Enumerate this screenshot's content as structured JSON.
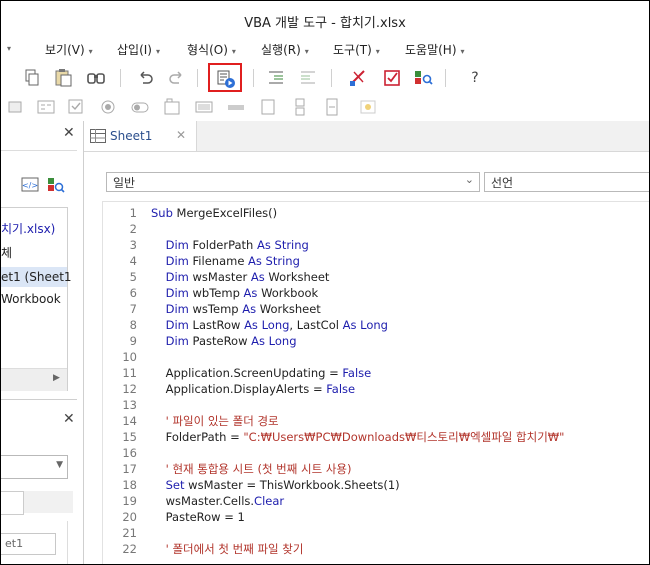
{
  "window": {
    "title": "VBA 개발 도구 - 합치기.xlsx"
  },
  "menu": [
    {
      "label": "보기(V)"
    },
    {
      "label": "삽입(I)"
    },
    {
      "label": "형식(O)"
    },
    {
      "label": "실행(R)"
    },
    {
      "label": "도구(T)"
    },
    {
      "label": "도움말(H)"
    }
  ],
  "toolbar": {
    "help_label": "?"
  },
  "project_panel": {
    "items": [
      "치기.xlsx)",
      "체",
      "et1 (Sheet1",
      "Workbook"
    ]
  },
  "properties_panel": {
    "field_value": "et1"
  },
  "code_window": {
    "tab_label": "Sheet1",
    "object_combo": "일반",
    "proc_combo": "선언"
  },
  "code_lines": [
    {
      "n": "1",
      "t": [
        {
          "c": "kw",
          "s": "Sub "
        },
        {
          "c": "id",
          "s": "MergeExcelFiles()"
        }
      ]
    },
    {
      "n": "2",
      "t": []
    },
    {
      "n": "3",
      "t": [
        {
          "c": "kw",
          "s": "    Dim "
        },
        {
          "c": "id",
          "s": "FolderPath "
        },
        {
          "c": "kw",
          "s": "As String"
        }
      ]
    },
    {
      "n": "4",
      "t": [
        {
          "c": "kw",
          "s": "    Dim "
        },
        {
          "c": "id",
          "s": "Filename "
        },
        {
          "c": "kw",
          "s": "As String"
        }
      ]
    },
    {
      "n": "5",
      "t": [
        {
          "c": "kw",
          "s": "    Dim "
        },
        {
          "c": "id",
          "s": "wsMaster "
        },
        {
          "c": "kw",
          "s": "As "
        },
        {
          "c": "id",
          "s": "Worksheet"
        }
      ]
    },
    {
      "n": "6",
      "t": [
        {
          "c": "kw",
          "s": "    Dim "
        },
        {
          "c": "id",
          "s": "wbTemp "
        },
        {
          "c": "kw",
          "s": "As "
        },
        {
          "c": "id",
          "s": "Workbook"
        }
      ]
    },
    {
      "n": "7",
      "t": [
        {
          "c": "kw",
          "s": "    Dim "
        },
        {
          "c": "id",
          "s": "wsTemp "
        },
        {
          "c": "kw",
          "s": "As "
        },
        {
          "c": "id",
          "s": "Worksheet"
        }
      ]
    },
    {
      "n": "8",
      "t": [
        {
          "c": "kw",
          "s": "    Dim "
        },
        {
          "c": "id",
          "s": "LastRow "
        },
        {
          "c": "kw",
          "s": "As Long"
        },
        {
          "c": "id",
          "s": ", LastCol "
        },
        {
          "c": "kw",
          "s": "As Long"
        }
      ]
    },
    {
      "n": "9",
      "t": [
        {
          "c": "kw",
          "s": "    Dim "
        },
        {
          "c": "id",
          "s": "PasteRow "
        },
        {
          "c": "kw",
          "s": "As Long"
        }
      ]
    },
    {
      "n": "10",
      "t": []
    },
    {
      "n": "11",
      "t": [
        {
          "c": "id",
          "s": "    Application.ScreenUpdating = "
        },
        {
          "c": "kw",
          "s": "False"
        }
      ]
    },
    {
      "n": "12",
      "t": [
        {
          "c": "id",
          "s": "    Application.DisplayAlerts = "
        },
        {
          "c": "kw",
          "s": "False"
        }
      ]
    },
    {
      "n": "13",
      "t": []
    },
    {
      "n": "14",
      "t": [
        {
          "c": "cm",
          "s": "    ' 파일이 있는 폴더 경로"
        }
      ]
    },
    {
      "n": "15",
      "t": [
        {
          "c": "id",
          "s": "    FolderPath = "
        },
        {
          "c": "str",
          "s": "\"C:₩Users₩PC₩Downloads₩티스토리₩엑셀파일 합치기₩\""
        }
      ]
    },
    {
      "n": "16",
      "t": []
    },
    {
      "n": "17",
      "t": [
        {
          "c": "cm",
          "s": "    ' 현재 통합용 시트 (첫 번째 시트 사용)"
        }
      ]
    },
    {
      "n": "18",
      "t": [
        {
          "c": "kw",
          "s": "    Set "
        },
        {
          "c": "id",
          "s": "wsMaster = ThisWorkbook.Sheets(1)"
        }
      ]
    },
    {
      "n": "19",
      "t": [
        {
          "c": "id",
          "s": "    wsMaster.Cells."
        },
        {
          "c": "kw",
          "s": "Clear"
        }
      ]
    },
    {
      "n": "20",
      "t": [
        {
          "c": "id",
          "s": "    PasteRow = 1"
        }
      ]
    },
    {
      "n": "21",
      "t": []
    },
    {
      "n": "22",
      "t": [
        {
          "c": "cm",
          "s": "    ' 폴더에서 첫 번째 파일 찾기"
        }
      ]
    }
  ]
}
